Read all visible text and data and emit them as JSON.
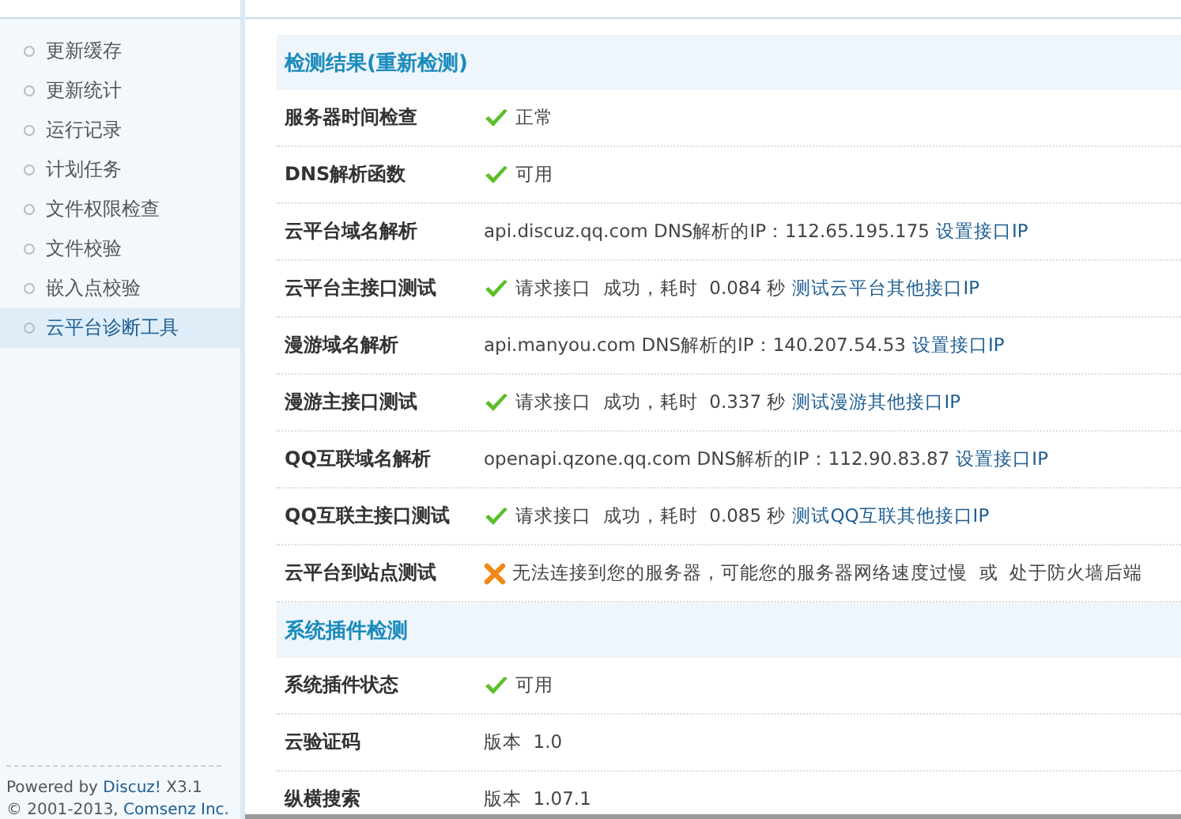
{
  "sidebar": {
    "items": [
      {
        "label": "更新缓存",
        "selected": false
      },
      {
        "label": "更新统计",
        "selected": false
      },
      {
        "label": "运行记录",
        "selected": false
      },
      {
        "label": "计划任务",
        "selected": false
      },
      {
        "label": "文件权限检查",
        "selected": false
      },
      {
        "label": "文件校验",
        "selected": false
      },
      {
        "label": "嵌入点校验",
        "selected": false
      },
      {
        "label": "云平台诊断工具",
        "selected": true
      }
    ],
    "footer": [
      {
        "before": "Powered by ",
        "link": "Discuz!",
        "after": " X3.1"
      },
      {
        "before": "© 2001-2013, ",
        "link": "Comsenz Inc."
      }
    ]
  },
  "sections": [
    {
      "title": "检测结果(重新检测)",
      "rows": [
        {
          "label": "服务器时间检查",
          "kind": "passed",
          "value": "正常"
        },
        {
          "label": "DNS解析函数",
          "kind": "passed",
          "value": "可用"
        },
        {
          "label": "云平台域名解析",
          "kind": "info",
          "value": "api.discuz.qq.com DNS解析的IP：112.65.195.175",
          "link": "设置接口IP"
        },
        {
          "label": "云平台主接口测试",
          "kind": "passed",
          "value": "请求接口  成功，耗时  0.084 秒",
          "link": "测试云平台其他接口IP"
        },
        {
          "label": "漫游域名解析",
          "kind": "info",
          "value": "api.manyou.com DNS解析的IP：140.207.54.53",
          "link": "设置接口IP"
        },
        {
          "label": "漫游主接口测试",
          "kind": "passed",
          "value": "请求接口  成功，耗时  0.337 秒",
          "link": "测试漫游其他接口IP"
        },
        {
          "label": "QQ互联域名解析",
          "kind": "info",
          "value": "openapi.qzone.qq.com DNS解析的IP：112.90.83.87",
          "link": "设置接口IP"
        },
        {
          "label": "QQ互联主接口测试",
          "kind": "passed",
          "value": "请求接口  成功，耗时  0.085 秒",
          "link": "测试QQ互联其他接口IP"
        },
        {
          "label": "云平台到站点测试",
          "kind": "failed",
          "value": "无法连接到您的服务器，可能您的服务器网络速度过慢  或  处于防火墙后端"
        }
      ]
    },
    {
      "title": "系统插件检测",
      "rows": [
        {
          "label": "系统插件状态",
          "kind": "passed",
          "value": "可用"
        },
        {
          "label": "云验证码",
          "kind": "info",
          "value": "版本  1.0"
        },
        {
          "label": "纵横搜索",
          "kind": "info",
          "value": "版本  1.07.1"
        }
      ]
    }
  ]
}
